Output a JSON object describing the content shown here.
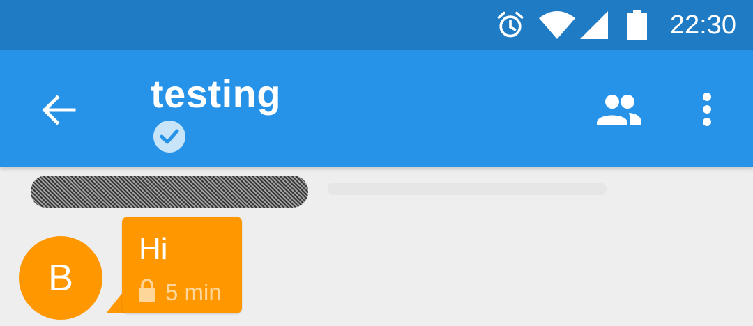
{
  "status_bar": {
    "time": "22:30",
    "icons": [
      "alarm-icon",
      "wifi-icon",
      "signal-icon",
      "battery-icon"
    ]
  },
  "toolbar": {
    "title": "testing",
    "icons": [
      "back-arrow-icon",
      "verified-check-icon",
      "people-icon",
      "more-vert-icon"
    ]
  },
  "messages": [
    {
      "sender_initial": "B",
      "text": "Hi",
      "time": "5 min",
      "icons": [
        "lock-icon"
      ]
    }
  ],
  "colors": {
    "status_bar": "#1f7bc4",
    "toolbar": "#2692e8",
    "background": "#eeeeee",
    "bubble": "#ff9800",
    "avatar": "#ff9800"
  }
}
